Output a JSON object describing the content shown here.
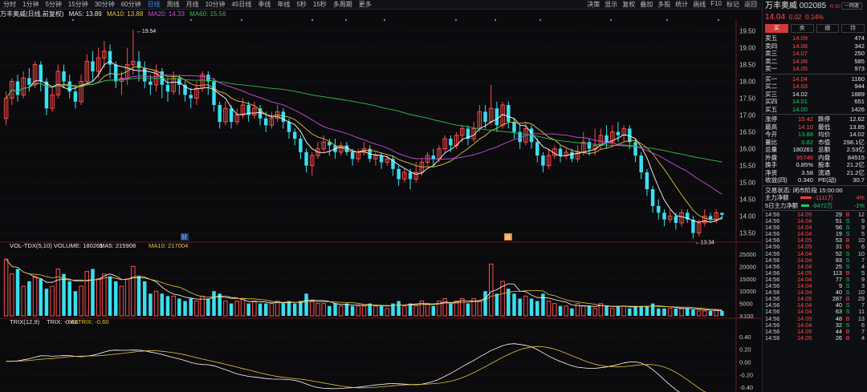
{
  "toolbar": {
    "periods": [
      "分时",
      "1分钟",
      "5分钟",
      "15分钟",
      "30分钟",
      "60分钟",
      "日线",
      "周线",
      "月线",
      "10分钟",
      "45日线",
      "季线",
      "年线",
      "5秒",
      "15秒",
      "多周期",
      "更多"
    ],
    "active": "日线",
    "right": [
      "决策",
      "显示",
      "复权",
      "叠加",
      "多股",
      "统计",
      "画线",
      "F10",
      "标记",
      "返回"
    ]
  },
  "title": {
    "name": "万丰奥威(日线,前复权)",
    "ma5": "MA5: 13.89",
    "ma10": "MA10: 13.88",
    "ma20": "MA20: 14.33",
    "ma60": "MA60: 15.56"
  },
  "colors": {
    "up": "#ff4b4b",
    "down": "#38e0f0",
    "ma5": "#ffffff",
    "ma10": "#e7c23a",
    "ma20": "#c94fd6",
    "ma60": "#2fbf4a",
    "grid": "#3a1e1e"
  },
  "chart_data": {
    "type": "candlestick",
    "price_axis": [
      "19.50",
      "19.00",
      "18.50",
      "18.00",
      "17.50",
      "17.00",
      "16.50",
      "16.00",
      "15.50",
      "15.00",
      "14.50",
      "14.00",
      "13.50"
    ],
    "ylim": [
      13.3,
      19.8
    ],
    "hi_label": "19.54",
    "lo_label": "13.34",
    "markers": [
      "财",
      "融"
    ],
    "candles": [
      [
        16.9,
        17.5,
        16.7,
        17.7
      ],
      [
        17.5,
        18.0,
        17.3,
        18.1
      ],
      [
        18.0,
        17.6,
        17.4,
        18.2
      ],
      [
        17.6,
        18.1,
        17.5,
        18.3
      ],
      [
        18.1,
        17.9,
        17.7,
        18.4
      ],
      [
        17.9,
        18.5,
        17.8,
        18.6
      ],
      [
        18.5,
        18.0,
        17.7,
        18.6
      ],
      [
        18.0,
        17.2,
        17.0,
        18.1
      ],
      [
        17.2,
        17.6,
        17.1,
        17.8
      ],
      [
        17.6,
        18.3,
        17.5,
        18.5
      ],
      [
        18.3,
        18.0,
        17.8,
        18.5
      ],
      [
        18.0,
        17.7,
        17.5,
        18.2
      ],
      [
        17.7,
        17.4,
        17.2,
        17.9
      ],
      [
        17.4,
        18.0,
        17.3,
        18.2
      ],
      [
        18.0,
        18.6,
        17.9,
        18.8
      ],
      [
        18.6,
        18.3,
        18.0,
        18.9
      ],
      [
        18.3,
        18.7,
        18.1,
        19.0
      ],
      [
        18.7,
        18.9,
        18.4,
        19.2
      ],
      [
        18.9,
        18.5,
        18.1,
        19.1
      ],
      [
        18.5,
        18.0,
        17.8,
        18.6
      ],
      [
        18.0,
        18.1,
        17.6,
        18.3
      ],
      [
        18.1,
        18.5,
        17.9,
        19.0
      ],
      [
        18.5,
        18.6,
        18.2,
        19.54
      ],
      [
        18.6,
        18.4,
        18.0,
        18.9
      ],
      [
        18.4,
        18.0,
        17.8,
        18.6
      ],
      [
        18.0,
        17.9,
        17.6,
        18.2
      ],
      [
        17.9,
        18.3,
        17.7,
        18.5
      ],
      [
        18.3,
        17.9,
        17.5,
        18.4
      ],
      [
        17.9,
        17.7,
        17.4,
        18.1
      ],
      [
        17.7,
        18.1,
        17.6,
        18.3
      ],
      [
        18.1,
        17.9,
        17.6,
        18.2
      ],
      [
        17.9,
        17.6,
        17.4,
        18.0
      ],
      [
        17.6,
        17.5,
        17.2,
        17.8
      ],
      [
        17.5,
        17.8,
        17.3,
        18.0
      ],
      [
        17.8,
        18.2,
        17.7,
        18.3
      ],
      [
        18.2,
        18.0,
        17.6,
        18.3
      ],
      [
        18.0,
        17.3,
        17.1,
        18.1
      ],
      [
        17.3,
        16.8,
        16.6,
        17.4
      ],
      [
        16.8,
        17.2,
        16.7,
        17.4
      ],
      [
        17.2,
        16.8,
        16.6,
        17.3
      ],
      [
        16.8,
        17.0,
        16.7,
        17.2
      ],
      [
        17.0,
        17.3,
        16.9,
        17.5
      ],
      [
        17.3,
        17.0,
        16.8,
        17.4
      ],
      [
        17.0,
        17.2,
        16.9,
        17.4
      ],
      [
        17.2,
        16.9,
        16.7,
        17.3
      ],
      [
        16.9,
        16.7,
        16.5,
        17.1
      ],
      [
        16.7,
        16.9,
        16.6,
        17.1
      ],
      [
        16.9,
        17.1,
        16.8,
        17.3
      ],
      [
        17.1,
        16.8,
        16.6,
        17.2
      ],
      [
        16.8,
        16.5,
        16.3,
        16.9
      ],
      [
        16.5,
        16.3,
        16.1,
        16.6
      ],
      [
        16.3,
        15.9,
        15.7,
        16.4
      ],
      [
        15.9,
        15.5,
        15.3,
        16.0
      ],
      [
        15.5,
        15.8,
        15.2,
        15.9
      ],
      [
        15.8,
        16.0,
        15.7,
        16.2
      ],
      [
        16.0,
        16.2,
        15.9,
        16.4
      ],
      [
        16.2,
        16.1,
        15.8,
        16.3
      ],
      [
        16.1,
        15.9,
        15.7,
        16.3
      ],
      [
        15.9,
        16.1,
        15.8,
        16.2
      ],
      [
        16.1,
        15.9,
        15.8,
        16.2
      ],
      [
        15.9,
        15.7,
        15.5,
        16.0
      ],
      [
        15.7,
        15.9,
        15.6,
        16.0
      ],
      [
        15.9,
        16.0,
        15.8,
        16.2
      ],
      [
        16.0,
        15.7,
        15.6,
        16.1
      ],
      [
        15.7,
        15.8,
        15.5,
        15.9
      ],
      [
        15.8,
        15.6,
        15.4,
        15.9
      ],
      [
        15.6,
        15.7,
        15.5,
        15.8
      ],
      [
        15.7,
        15.4,
        15.2,
        15.8
      ],
      [
        15.4,
        15.1,
        14.9,
        15.5
      ],
      [
        15.1,
        15.3,
        15.0,
        15.4
      ],
      [
        15.3,
        15.1,
        14.8,
        15.4
      ],
      [
        15.1,
        15.3,
        15.0,
        15.6
      ],
      [
        15.3,
        15.6,
        15.2,
        15.7
      ],
      [
        15.6,
        15.8,
        15.5,
        15.9
      ],
      [
        15.8,
        15.7,
        15.5,
        16.0
      ],
      [
        15.7,
        16.0,
        15.6,
        16.1
      ],
      [
        16.0,
        16.3,
        15.9,
        16.4
      ],
      [
        16.3,
        16.1,
        15.9,
        16.4
      ],
      [
        16.1,
        16.4,
        16.0,
        16.5
      ],
      [
        16.4,
        16.6,
        16.2,
        16.7
      ],
      [
        16.6,
        16.3,
        16.1,
        16.7
      ],
      [
        16.3,
        16.6,
        16.2,
        16.8
      ],
      [
        16.6,
        17.1,
        16.5,
        17.3
      ],
      [
        17.1,
        16.8,
        16.6,
        17.3
      ],
      [
        16.8,
        17.2,
        16.7,
        17.9
      ],
      [
        17.2,
        16.7,
        16.5,
        17.4
      ],
      [
        16.7,
        17.3,
        16.6,
        17.4
      ],
      [
        17.3,
        16.8,
        16.6,
        17.4
      ],
      [
        16.8,
        16.5,
        16.3,
        16.9
      ],
      [
        16.5,
        16.2,
        16.0,
        16.7
      ],
      [
        16.2,
        16.6,
        16.1,
        16.8
      ],
      [
        16.6,
        16.2,
        16.0,
        16.7
      ],
      [
        16.2,
        15.8,
        15.6,
        16.3
      ],
      [
        15.8,
        15.5,
        15.3,
        15.9
      ],
      [
        15.5,
        15.8,
        15.4,
        16.0
      ],
      [
        15.8,
        16.0,
        15.7,
        16.1
      ],
      [
        16.0,
        15.8,
        15.6,
        16.1
      ],
      [
        15.8,
        15.9,
        15.7,
        16.0
      ],
      [
        15.9,
        15.7,
        15.6,
        16.0
      ],
      [
        15.7,
        15.9,
        15.6,
        16.1
      ],
      [
        15.9,
        16.2,
        15.8,
        16.5
      ],
      [
        16.2,
        16.0,
        15.8,
        16.3
      ],
      [
        16.0,
        16.1,
        15.8,
        16.6
      ],
      [
        16.1,
        16.4,
        16.0,
        16.6
      ],
      [
        16.4,
        16.2,
        16.0,
        16.7
      ],
      [
        16.2,
        16.5,
        16.1,
        16.7
      ],
      [
        16.5,
        16.4,
        16.2,
        16.8
      ],
      [
        16.4,
        16.6,
        16.2,
        16.7
      ],
      [
        16.6,
        16.2,
        16.0,
        16.7
      ],
      [
        16.2,
        15.8,
        15.6,
        16.3
      ],
      [
        15.8,
        15.3,
        15.1,
        15.9
      ],
      [
        15.3,
        14.8,
        14.6,
        15.4
      ],
      [
        14.8,
        14.3,
        14.1,
        14.9
      ],
      [
        14.3,
        14.1,
        13.9,
        14.5
      ],
      [
        14.1,
        13.9,
        13.7,
        14.2
      ],
      [
        13.9,
        14.0,
        13.8,
        14.2
      ],
      [
        14.0,
        13.8,
        13.6,
        14.1
      ],
      [
        13.8,
        14.1,
        13.7,
        14.2
      ],
      [
        14.1,
        13.9,
        13.8,
        14.2
      ],
      [
        13.9,
        13.5,
        13.34,
        14.0
      ],
      [
        13.5,
        13.8,
        13.4,
        13.9
      ],
      [
        13.8,
        14.0,
        13.7,
        14.2
      ],
      [
        14.0,
        13.9,
        13.8,
        14.1
      ],
      [
        13.9,
        14.1,
        13.8,
        14.2
      ],
      [
        14.1,
        14.04,
        13.9,
        14.1
      ]
    ]
  },
  "volume": {
    "label": "VOL-TDX(5,10)",
    "vol": "VOLUME: 180261",
    "ma5": "MA5: 215908",
    "ma10": "MA10: 217004",
    "axis": [
      "25000",
      "20000",
      "15000",
      "10000",
      "5000",
      "X100"
    ],
    "ymax": 26000,
    "values": [
      23000,
      17000,
      19000,
      12000,
      14000,
      16000,
      15000,
      11000,
      12000,
      19000,
      17000,
      14000,
      10000,
      12000,
      18000,
      19000,
      15000,
      17000,
      16000,
      14000,
      12000,
      15000,
      20000,
      16000,
      14000,
      9000,
      10000,
      9000,
      8000,
      8000,
      7000,
      6000,
      7000,
      6000,
      8000,
      7000,
      10000,
      9000,
      6000,
      5000,
      6000,
      7000,
      5000,
      6000,
      5000,
      5000,
      5000,
      6000,
      5000,
      6000,
      5000,
      6000,
      9000,
      6000,
      5000,
      5000,
      4000,
      5000,
      4000,
      5000,
      4000,
      4000,
      4000,
      5000,
      4000,
      4000,
      3000,
      5000,
      6000,
      4000,
      5000,
      4000,
      6000,
      5000,
      4000,
      6000,
      7000,
      5000,
      6000,
      7000,
      5000,
      7000,
      6000,
      10000,
      21000,
      9000,
      14000,
      11000,
      9000,
      7000,
      8000,
      7000,
      6000,
      9000,
      6000,
      5000,
      4000,
      4000,
      3000,
      5000,
      4000,
      4000,
      3000,
      5000,
      4000,
      3000,
      4000,
      4000,
      3000,
      4000,
      4000,
      4000,
      5000,
      3000,
      3000,
      3000,
      3000,
      3000,
      3000,
      2500,
      2000,
      2000,
      2000,
      2500,
      2000
    ]
  },
  "trix": {
    "label": "TRIX(12,9)",
    "trix": "TRIX: -0.60",
    "matrix": "MATRIX: -0.60",
    "axis": [
      "0.40",
      "0.20",
      "0.00",
      "-0.20",
      "-0.40"
    ]
  },
  "quote": {
    "name": "万丰奥威",
    "code": "002085",
    "badge": "R 50",
    "button": "一网速",
    "price": "14.04",
    "chg": "0.02",
    "pct": "0.14%",
    "tabs": [
      "买",
      "卖",
      "撤",
      "持"
    ]
  },
  "asks": [
    [
      "卖五",
      "14.09",
      "474"
    ],
    [
      "卖四",
      "14.08",
      "342"
    ],
    [
      "卖三",
      "14.07",
      "250"
    ],
    [
      "卖二",
      "14.06",
      "585"
    ],
    [
      "卖一",
      "14.05",
      "973"
    ]
  ],
  "bids": [
    [
      "买一",
      "14.04",
      "1160"
    ],
    [
      "买二",
      "14.03",
      "944"
    ],
    [
      "买三",
      "14.02",
      "1889"
    ],
    [
      "买四",
      "14.01",
      "651"
    ],
    [
      "买五",
      "14.00",
      "1426"
    ]
  ],
  "stats": [
    [
      "涨停",
      "15.42",
      "跌停",
      "12.62"
    ],
    [
      "最高",
      "14.10",
      "最低",
      "13.85"
    ],
    [
      "今开",
      "13.88",
      "均价",
      "14.02"
    ],
    [
      "量比",
      "0.82",
      "市值",
      "298.1亿"
    ],
    [
      "总量",
      "180261",
      "总额",
      "2.53亿"
    ],
    [
      "外盘",
      "95746",
      "内盘",
      "84515"
    ],
    [
      "换手",
      "0.85%",
      "股本",
      "21.2亿"
    ],
    [
      "净资",
      "3.58",
      "流通",
      "21.2亿"
    ],
    [
      "收益(四)",
      "0.340",
      "PE(动)",
      "30.7"
    ]
  ],
  "status": "交易状态: 闭市阶段 15:00:00",
  "flows": [
    [
      "主力净额",
      "-1111万",
      "4%"
    ],
    [
      "5日主力净额",
      "-9472万",
      "-1%"
    ]
  ],
  "ticks": [
    [
      "14:56",
      "14.05",
      "29",
      "B",
      "12"
    ],
    [
      "14:56",
      "14.04",
      "51",
      "S",
      "9"
    ],
    [
      "14:56",
      "14.04",
      "56",
      "S",
      "9"
    ],
    [
      "14:56",
      "14.04",
      "19",
      "S",
      "5"
    ],
    [
      "14:56",
      "14.05",
      "53",
      "B",
      "10"
    ],
    [
      "14:56",
      "14.05",
      "31",
      "B",
      "6"
    ],
    [
      "14:56",
      "14.04",
      "52",
      "S",
      "10"
    ],
    [
      "14:56",
      "14.04",
      "83",
      "S",
      "7"
    ],
    [
      "14:56",
      "14.04",
      "25",
      "S",
      "4"
    ],
    [
      "14:56",
      "14.05",
      "113",
      "B",
      "5"
    ],
    [
      "14:56",
      "14.04",
      "77",
      "S",
      "9"
    ],
    [
      "14:56",
      "14.04",
      "9",
      "S",
      "3"
    ],
    [
      "14:56",
      "14.04",
      "40",
      "S",
      "10"
    ],
    [
      "14:56",
      "14.05",
      "287",
      "B",
      "29"
    ],
    [
      "14:56",
      "14.04",
      "40",
      "S",
      "7"
    ],
    [
      "14:56",
      "14.04",
      "63",
      "S",
      "11"
    ],
    [
      "14:56",
      "14.05",
      "48",
      "B",
      "13"
    ],
    [
      "14:56",
      "14.04",
      "32",
      "S",
      "6"
    ],
    [
      "14:56",
      "14.05",
      "44",
      "B",
      "7"
    ],
    [
      "14:56",
      "14.05",
      "26",
      "B",
      "4"
    ]
  ]
}
